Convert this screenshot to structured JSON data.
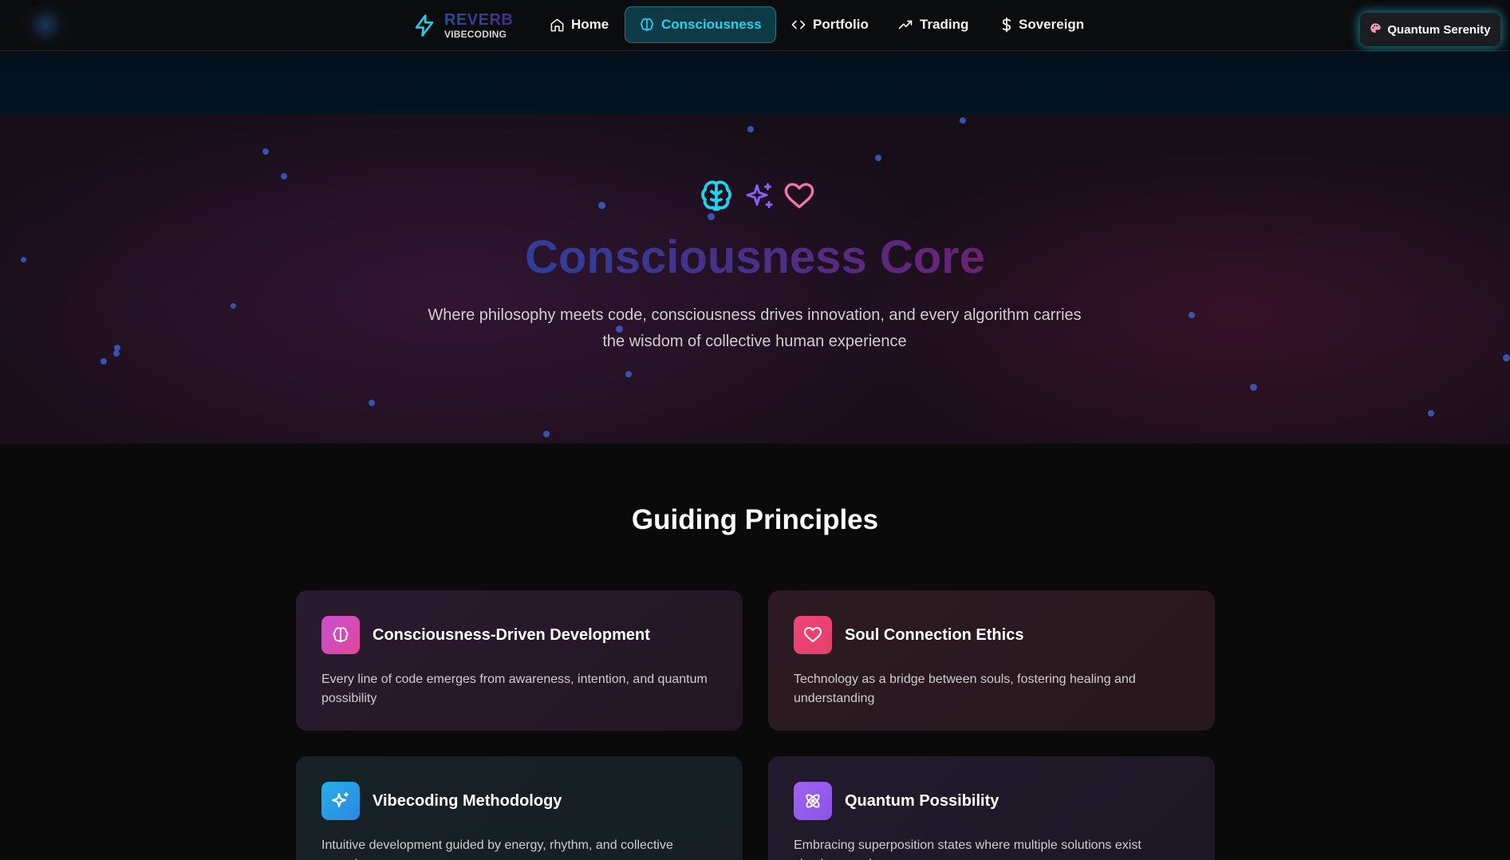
{
  "nav": {
    "brand_title": "REVERB",
    "brand_sub": "VIBECODING",
    "items": [
      {
        "label": "Home",
        "icon": "home-icon"
      },
      {
        "label": "Consciousness",
        "icon": "brain-icon",
        "active": true
      },
      {
        "label": "Portfolio",
        "icon": "code-icon"
      },
      {
        "label": "Trading",
        "icon": "trending-up-icon"
      },
      {
        "label": "Sovereign",
        "icon": "dollar-icon"
      }
    ],
    "theme_button": "Quantum Serenity",
    "theme_icon": "palette-icon"
  },
  "hero": {
    "icons": [
      "brain-icon",
      "sparkles-icon",
      "heart-icon"
    ],
    "title": "Consciousness Core",
    "subtitle_line1": "Where philosophy meets code, consciousness drives innovation, and every algorithm carries",
    "subtitle_line2": "the wisdom of collective human experience"
  },
  "principles": {
    "title": "Guiding Principles",
    "cards": [
      {
        "title": "Consciousness-Driven Development",
        "desc": "Every line of code emerges from awareness, intention, and quantum possibility",
        "icon": "brain-icon",
        "color": "#c94fd0"
      },
      {
        "title": "Soul Connection Ethics",
        "desc": "Technology as a bridge between souls, fostering healing and understanding",
        "icon": "heart-icon",
        "color": "#ef4f7a"
      },
      {
        "title": "Vibecoding Methodology",
        "desc": "Intuitive development guided by energy, rhythm, and collective consciousness",
        "icon": "sparkles-icon",
        "color": "#2aa6e8"
      },
      {
        "title": "Quantum Possibility",
        "desc": "Embracing superposition states where multiple solutions exist simultaneously",
        "icon": "atom-icon",
        "color": "#9a5cf0"
      }
    ]
  },
  "colors": {
    "accent": "#22d3ee",
    "background": "#0a0a0b",
    "hero_gradient_start": "#2f3f98",
    "hero_gradient_end": "#6a2373"
  }
}
